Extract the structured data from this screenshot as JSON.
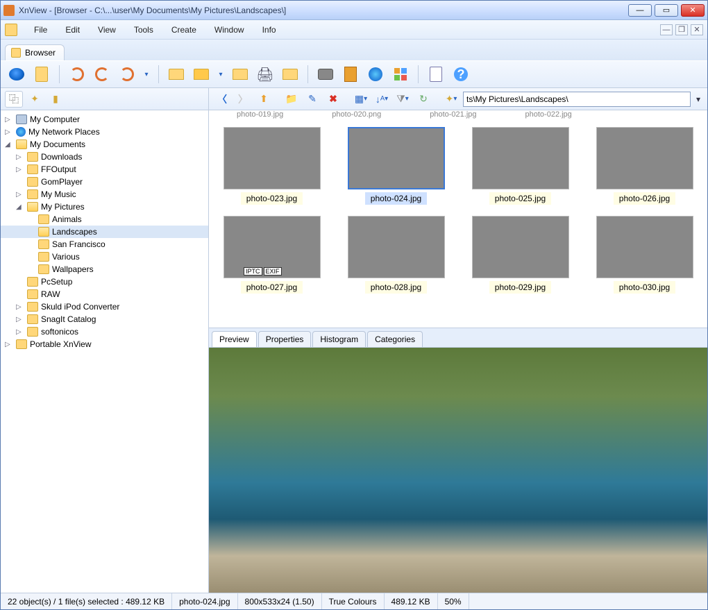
{
  "window": {
    "title": "XnView - [Browser - C:\\...\\user\\My Documents\\My Pictures\\Landscapes\\]"
  },
  "menu": {
    "file": "File",
    "edit": "Edit",
    "view": "View",
    "tools": "Tools",
    "create": "Create",
    "window": "Window",
    "info": "Info"
  },
  "tabs": {
    "browser": "Browser"
  },
  "path_field": "ts\\My Pictures\\Landscapes\\",
  "tree": {
    "mycomputer": "My Computer",
    "network": "My Network Places",
    "mydocs": "My Documents",
    "downloads": "Downloads",
    "ffoutput": "FFOutput",
    "gomplayer": "GomPlayer",
    "mymusic": "My Music",
    "mypictures": "My Pictures",
    "animals": "Animals",
    "landscapes": "Landscapes",
    "sanfran": "San Francisco",
    "various": "Various",
    "wallpapers": "Wallpapers",
    "pcsetup": "PcSetup",
    "raw": "RAW",
    "skuld": "Skuld iPod Converter",
    "snagit": "SnagIt Catalog",
    "softonicos": "softonicos",
    "portable": "Portable XnView"
  },
  "ghost_row": {
    "a": "photo-019.jpg",
    "b": "photo-020.png",
    "c": "photo-021.jpg",
    "d": "photo-022.jpg"
  },
  "thumbs": [
    {
      "file": "photo-023.jpg"
    },
    {
      "file": "photo-024.jpg"
    },
    {
      "file": "photo-025.jpg"
    },
    {
      "file": "photo-026.jpg"
    },
    {
      "file": "photo-027.jpg"
    },
    {
      "file": "photo-028.jpg"
    },
    {
      "file": "photo-029.jpg"
    },
    {
      "file": "photo-030.jpg"
    }
  ],
  "badges": {
    "iptc": "IPTC",
    "exif": "EXIF"
  },
  "preview_tabs": {
    "preview": "Preview",
    "properties": "Properties",
    "histogram": "Histogram",
    "categories": "Categories"
  },
  "status": {
    "objects": "22 object(s) / 1 file(s) selected : 489.12 KB",
    "filename": "photo-024.jpg",
    "dims": "800x533x24 (1.50)",
    "colours": "True Colours",
    "size": "489.12 KB",
    "zoom": "50%"
  }
}
